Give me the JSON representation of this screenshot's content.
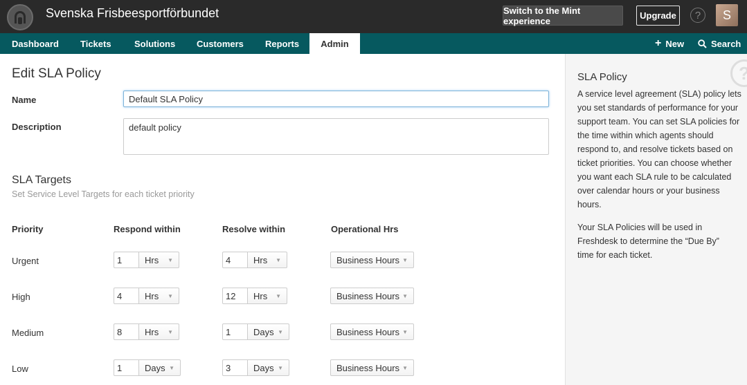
{
  "topbar": {
    "app_title": "Svenska Frisbeesportförbundet",
    "mint_button": "Switch to the Mint experience",
    "upgrade_button": "Upgrade",
    "help_glyph": "?",
    "avatar_initial": "S",
    "logo_icon": "headset-icon"
  },
  "nav": {
    "tabs": [
      {
        "label": "Dashboard"
      },
      {
        "label": "Tickets"
      },
      {
        "label": "Solutions"
      },
      {
        "label": "Customers"
      },
      {
        "label": "Reports"
      },
      {
        "label": "Admin",
        "active": true
      }
    ],
    "new_label": "New",
    "search_label": "Search"
  },
  "form": {
    "title": "Edit SLA Policy",
    "name_label": "Name",
    "name_value": "Default SLA Policy",
    "description_label": "Description",
    "description_value": "default policy"
  },
  "targets": {
    "title": "SLA Targets",
    "subtitle": "Set Service Level Targets for each ticket priority",
    "columns": [
      "Priority",
      "Respond within",
      "Resolve within",
      "Operational Hrs"
    ],
    "rows": [
      {
        "priority": "Urgent",
        "respond_value": "1",
        "respond_unit": "Hrs",
        "resolve_value": "4",
        "resolve_unit": "Hrs",
        "operational": "Business Hours"
      },
      {
        "priority": "High",
        "respond_value": "4",
        "respond_unit": "Hrs",
        "resolve_value": "12",
        "resolve_unit": "Hrs",
        "operational": "Business Hours"
      },
      {
        "priority": "Medium",
        "respond_value": "8",
        "respond_unit": "Hrs",
        "resolve_value": "1",
        "resolve_unit": "Days",
        "operational": "Business Hours"
      },
      {
        "priority": "Low",
        "respond_value": "1",
        "respond_unit": "Days",
        "resolve_value": "3",
        "resolve_unit": "Days",
        "operational": "Business Hours"
      }
    ]
  },
  "sidebar": {
    "title": "SLA Policy",
    "paragraph1": "A service level agreement (SLA) policy lets you set standards of performance for your support team. You can set SLA policies for the time within which agents should respond to, and resolve tickets based on ticket priorities. You can choose whether you want each SLA rule to be calculated over calendar hours or your business hours.",
    "paragraph2": "Your SLA Policies will be used in Freshdesk to determine the “Due By” time for each ticket.",
    "help_glyph": "?"
  },
  "colors": {
    "topbar_bg": "#2a2a2a",
    "nav_bg": "#06595f",
    "sidebar_bg": "#f5f5f5"
  }
}
